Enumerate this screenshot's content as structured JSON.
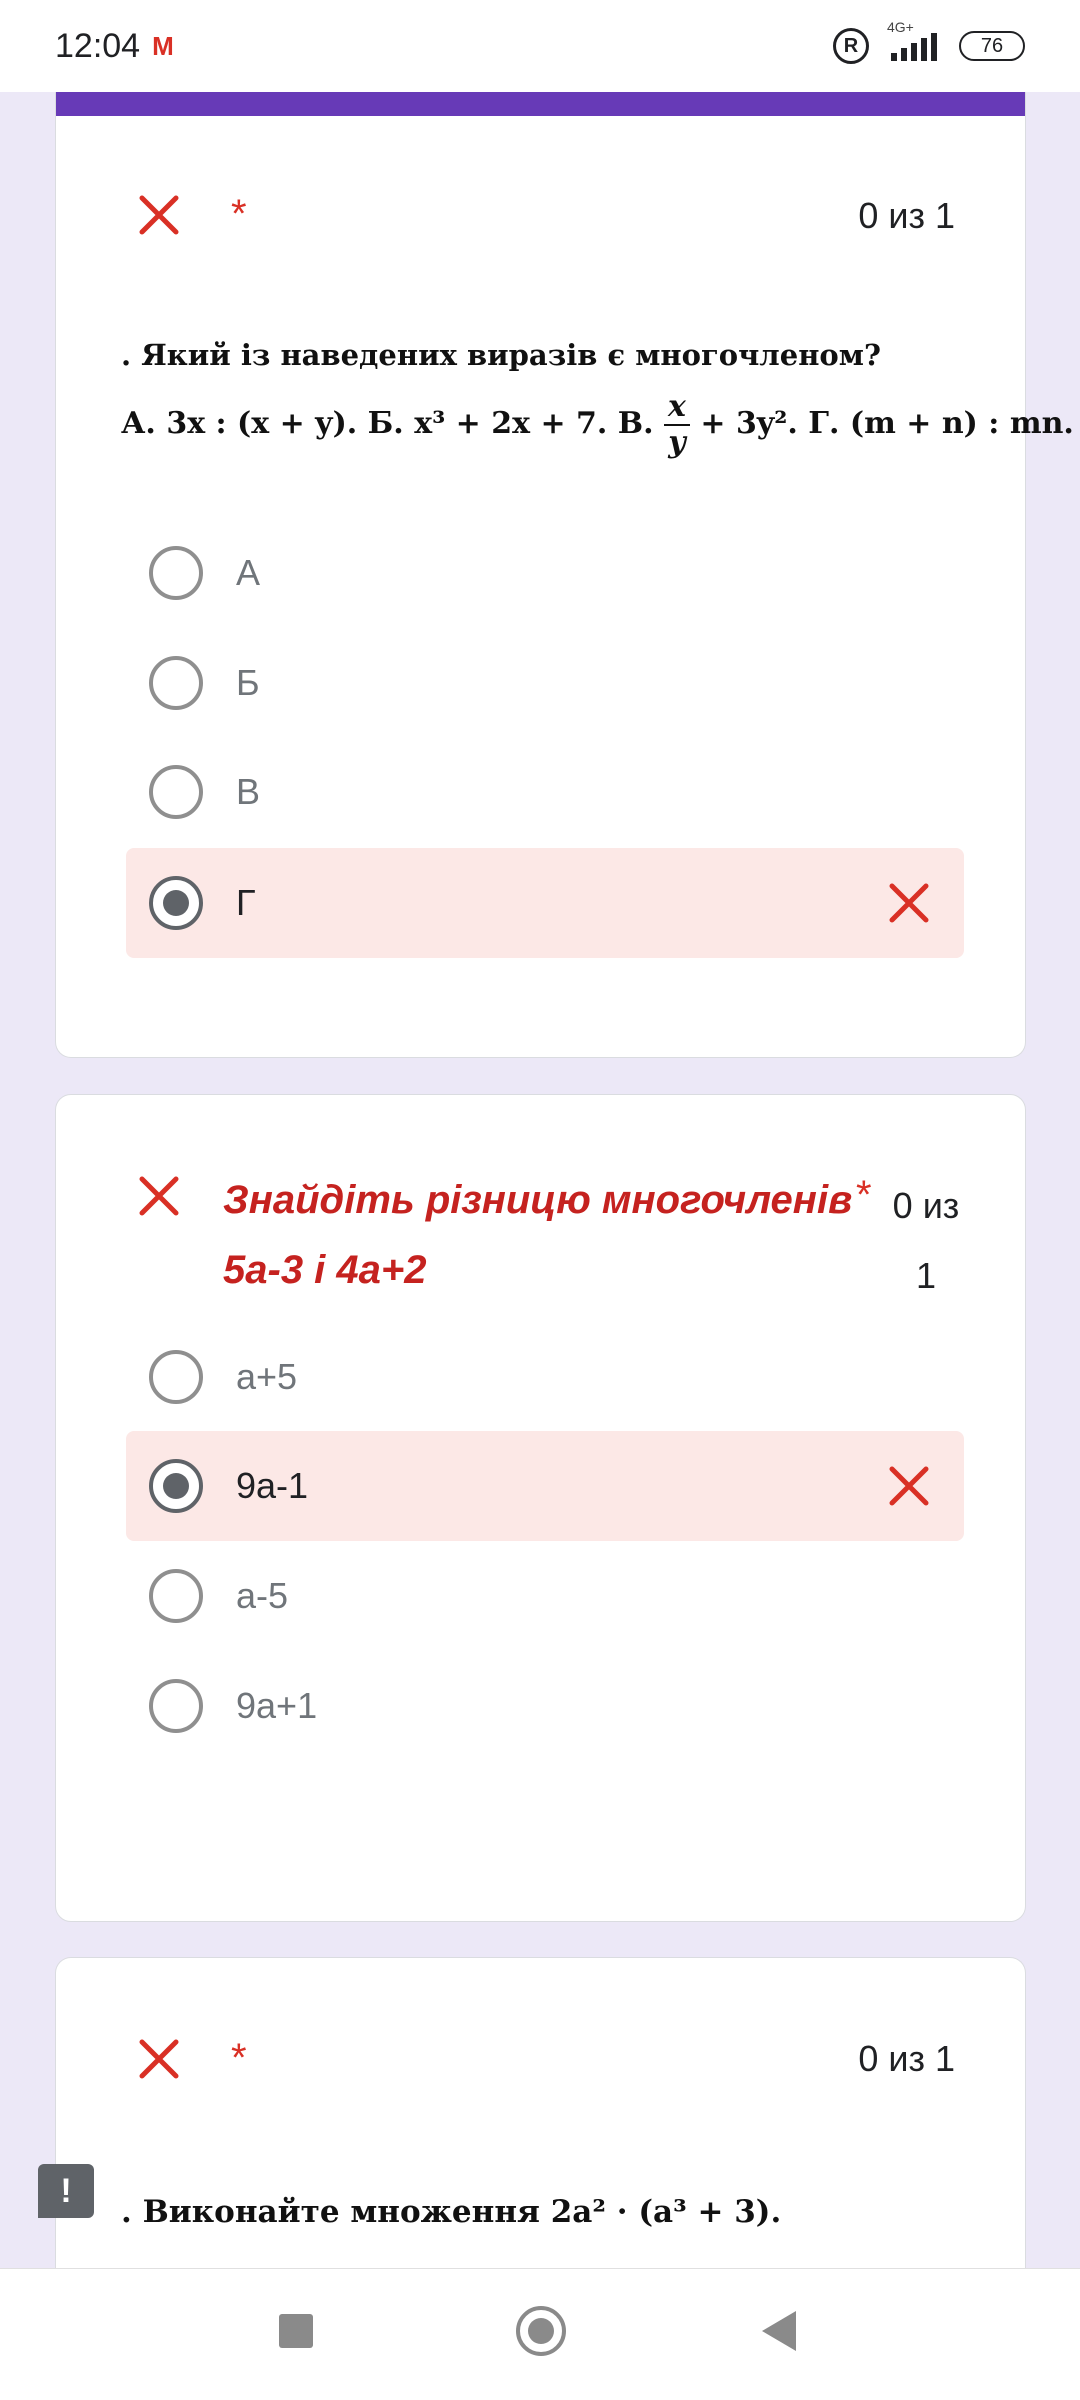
{
  "status_bar": {
    "time": "12:04",
    "mail_icon": "M",
    "registered_icon": "R",
    "network_type": "4G+",
    "battery": "76"
  },
  "questions": [
    {
      "asterisk": "*",
      "score": "0 из 1",
      "image_text": {
        "line1": ". Який із наведених виразів є многочленом?",
        "line2_a": "А. 3x : (x + y).  Б. x³ + 2x + 7.  В. ",
        "frac_num": "x",
        "frac_den": "y",
        "line2_b": " + 3y².  Г. (m + n) : mn."
      },
      "options": [
        {
          "label": "А",
          "selected": false
        },
        {
          "label": "Б",
          "selected": false
        },
        {
          "label": "В",
          "selected": false
        },
        {
          "label": "Г",
          "selected": true,
          "status": "wrong"
        }
      ]
    },
    {
      "title": "Знайдіть різницю многочленів 5а-3 і 4а+2",
      "asterisk": "*",
      "score_line1": "0 из",
      "score_line2": "1",
      "options": [
        {
          "label": "а+5",
          "selected": false
        },
        {
          "label": "9а-1",
          "selected": true,
          "status": "wrong"
        },
        {
          "label": "а-5",
          "selected": false
        },
        {
          "label": "9а+1",
          "selected": false
        }
      ]
    },
    {
      "asterisk": "*",
      "score": "0 из 1",
      "image_text": ". Виконайте множення 2a² · (a³ + 3)."
    }
  ],
  "feedback_button": "!",
  "colors": {
    "accent": "#673ab7",
    "error": "#d93025",
    "wrong_bg": "#fce8e6",
    "page_bg": "#ece8f7"
  },
  "icons": [
    "close-x-icon",
    "radio-icon",
    "feedback-icon",
    "nav-recents-icon",
    "nav-home-icon",
    "nav-back-icon"
  ]
}
